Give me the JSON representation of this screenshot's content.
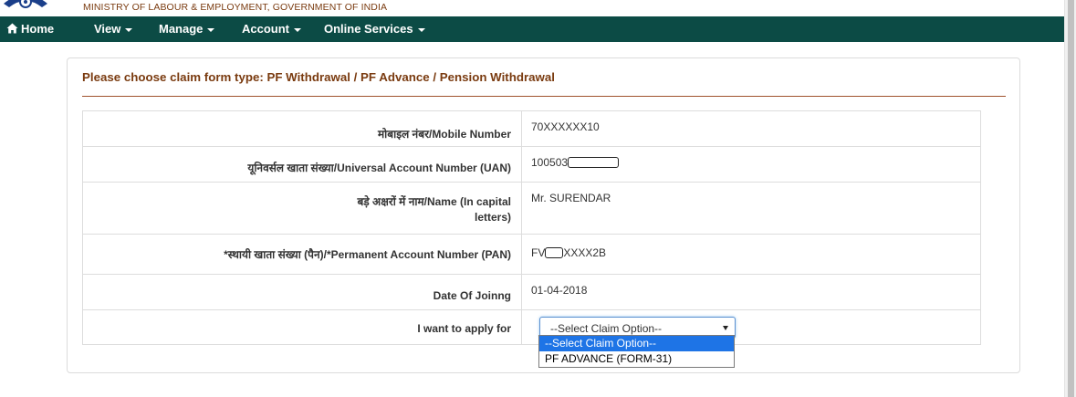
{
  "header": {
    "ministry": "MINISTRY OF LABOUR & EMPLOYMENT, GOVERNMENT OF INDIA"
  },
  "nav": {
    "items": [
      {
        "label": "Home",
        "icon": "home-icon"
      },
      {
        "label": "View",
        "icon": "caret-down-icon"
      },
      {
        "label": "Manage",
        "icon": "caret-down-icon"
      },
      {
        "label": "Account",
        "icon": "caret-down-icon"
      },
      {
        "label": "Online Services",
        "icon": "caret-down-icon"
      }
    ]
  },
  "panel": {
    "title": "Please choose claim form type: PF Withdrawal / PF Advance / Pension Withdrawal"
  },
  "form": {
    "rows": [
      {
        "label": "मोबाइल नंबर/Mobile Number",
        "value": "70XXXXXX10"
      },
      {
        "label": "यूनिवर्सल खाता संख्या/Universal Account Number (UAN)",
        "value_prefix": "100503"
      },
      {
        "label": "बड़े अक्षरों में नाम/Name (In capital letters)",
        "value": "Mr. SURENDAR"
      },
      {
        "label": "*स्थायी खाता संख्या (पैन)/*Permanent Account Number (PAN)",
        "value_prefix": "FV",
        "value_suffix": "XXXX2B"
      },
      {
        "label": "Date Of Joinng",
        "value": "01-04-2018"
      },
      {
        "label": "I want to apply for"
      }
    ],
    "select": {
      "selected": "--Select Claim Option--",
      "options": [
        "--Select Claim Option--",
        "PF ADVANCE (FORM-31)"
      ]
    }
  },
  "colors": {
    "navbar": "#0c4b45",
    "title": "#7a3b10",
    "selected_option": "#1e74e6"
  }
}
